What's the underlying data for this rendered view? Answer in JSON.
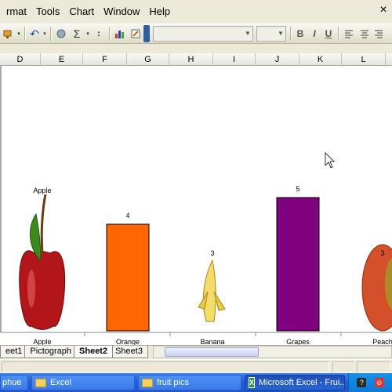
{
  "menubar": {
    "items": [
      "rmat",
      "Tools",
      "Chart",
      "Window",
      "Help"
    ],
    "underline": [
      "",
      "T",
      "C",
      "W",
      "H"
    ]
  },
  "toolbar": {
    "font_name": "",
    "font_size": "",
    "bold": "B",
    "italic": "I",
    "underline": "U",
    "sigma": "Σ"
  },
  "columns": [
    "D",
    "E",
    "F",
    "G",
    "H",
    "I",
    "J",
    "K",
    "L"
  ],
  "chart_data": {
    "type": "bar",
    "categories": [
      "Apple",
      "Orange",
      "Banana",
      "Grapes",
      "Peach"
    ],
    "values": [
      6,
      4,
      3,
      5,
      3
    ],
    "data_labels": [
      "Apple",
      "4",
      "3",
      "5",
      "3"
    ],
    "colors": {
      "Orange": "#ff6600",
      "Grapes": "#800080"
    },
    "picture_fill": [
      "Apple",
      "Banana",
      "Peach"
    ]
  },
  "sheet_tabs": [
    "eet1",
    "Pictograph",
    "Sheet2",
    "Sheet3"
  ],
  "active_tab": "Sheet2",
  "taskbar": {
    "items": [
      "phue",
      "Excel",
      "fruit pics",
      "Microsoft Excel - Frui..."
    ],
    "tray": [
      "?",
      "⊘"
    ]
  }
}
